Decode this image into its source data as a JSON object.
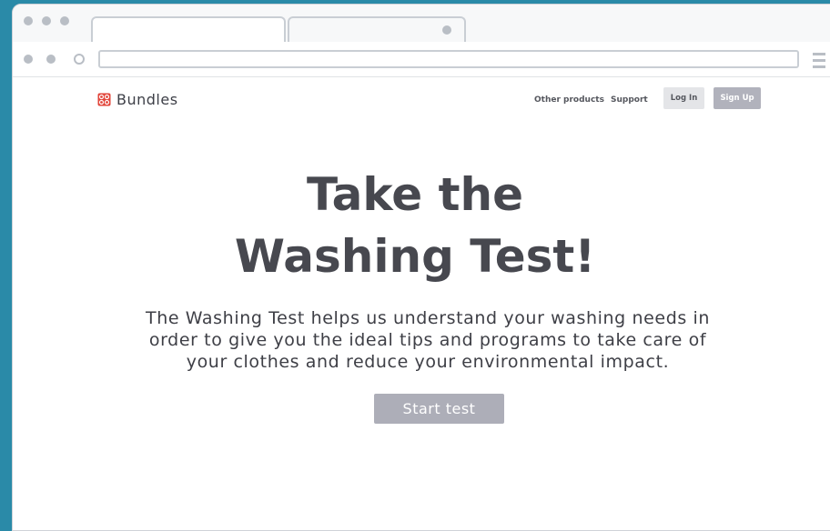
{
  "browser": {
    "address_value": ""
  },
  "navbar": {
    "brand": "Bundles",
    "links": [
      "Other products",
      "Support"
    ],
    "login_label": "Log In",
    "signup_label": "Sign Up"
  },
  "hero": {
    "title_lines": [
      "Take the",
      "Washing Test!"
    ],
    "description_lines": [
      "The Washing Test helps us understand your washing needs in",
      "order to give you the ideal tips and programs to take care of",
      "your clothes and reduce your environmental impact."
    ],
    "cta_label": "Start test"
  },
  "colors": {
    "background": "#2a8aa8",
    "brand_accent": "#e2453a",
    "title_text": "#47484f",
    "primary_button": "#adaeb8",
    "secondary_button": "#e4e5e8"
  },
  "icons": {
    "brand_logo": "bundles-logo-icon",
    "menu": "hamburger-menu-icon"
  }
}
